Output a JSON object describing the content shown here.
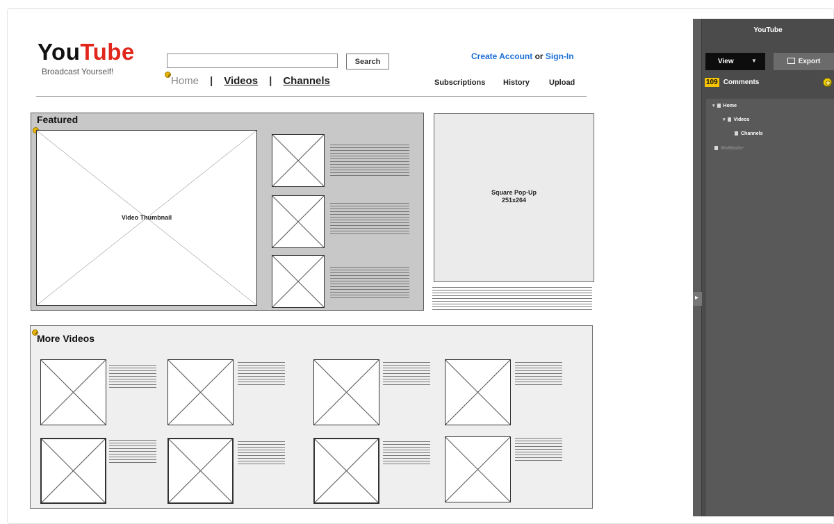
{
  "header": {
    "logo_part1": "You",
    "logo_part2": "Tube",
    "tagline": "Broadcast Yourself!",
    "search_button": "Search",
    "search_value": "",
    "nav": {
      "home": "Home",
      "sep1": "|",
      "videos": "Videos",
      "sep2": "|",
      "channels": "Channels"
    },
    "account": {
      "create": "Create Account",
      "or": " or ",
      "signin": "Sign-In"
    },
    "subnav": {
      "subscriptions": "Subscriptions",
      "history": "History",
      "upload": "Upload"
    }
  },
  "featured": {
    "title": "Featured",
    "main_thumb_label": "Video Thumbnail"
  },
  "popup": {
    "line1": "Square Pop-Up",
    "line2": "251x264"
  },
  "more_videos": {
    "title": "More Videos"
  },
  "sidepanel": {
    "title": "YouTube",
    "view_label": "View",
    "export_label": "Export",
    "comments_count": "109",
    "comments_label": "Comments",
    "tree": [
      {
        "label": "Home"
      },
      {
        "label": "Videos"
      },
      {
        "label": "Channels"
      },
      {
        "label": "MoMaster"
      }
    ]
  },
  "colors": {
    "brand_red": "#e1261c",
    "link_blue": "#1a6fd6",
    "badge_yellow": "#f5c400",
    "panel_dark": "#4b4b4b"
  }
}
